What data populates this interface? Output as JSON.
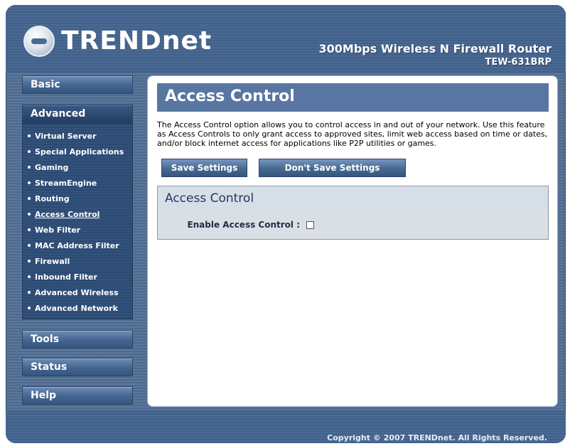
{
  "header": {
    "brand": "TRENDnet",
    "product_name": "300Mbps Wireless N Firewall Router",
    "model": "TEW-631BRP"
  },
  "sidebar": {
    "basic": "Basic",
    "advanced": "Advanced",
    "tools": "Tools",
    "status": "Status",
    "help": "Help",
    "advanced_items": [
      {
        "label": "Virtual Server"
      },
      {
        "label": "Special Applications"
      },
      {
        "label": "Gaming"
      },
      {
        "label": "StreamEngine"
      },
      {
        "label": "Routing"
      },
      {
        "label": "Access Control",
        "current": true
      },
      {
        "label": "Web Filter"
      },
      {
        "label": "MAC Address Filter"
      },
      {
        "label": "Firewall"
      },
      {
        "label": "Inbound Filter"
      },
      {
        "label": "Advanced Wireless"
      },
      {
        "label": "Advanced Network"
      }
    ]
  },
  "main": {
    "title": "Access Control",
    "description": "The Access Control option allows you to control access in and out of your network. Use this feature as Access Controls to only grant access to approved sites, limit web access based on time or dates, and/or block internet access for applications like P2P utilities or games.",
    "save_button": "Save Settings",
    "dont_save_button": "Don't Save Settings",
    "section_title": "Access Control",
    "enable_label": "Enable Access Control :",
    "enable_checked": false
  },
  "footer": {
    "copyright": "Copyright © 2007 TRENDnet. All Rights Reserved."
  }
}
